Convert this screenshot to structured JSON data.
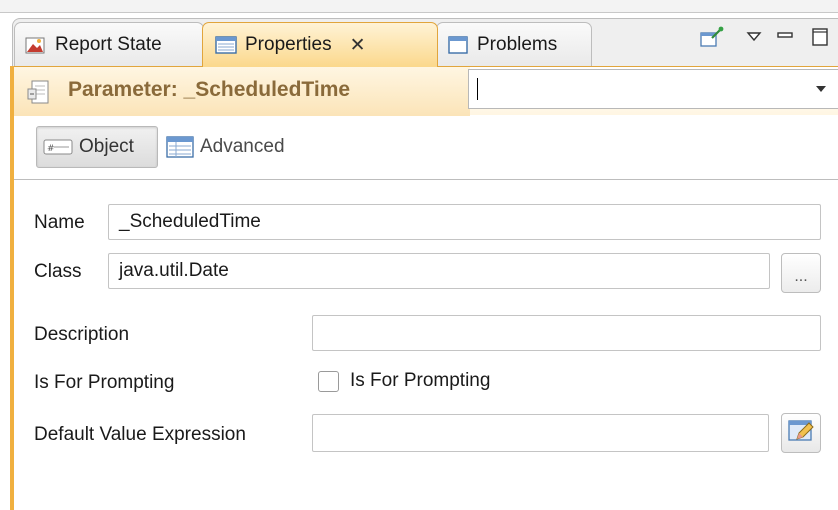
{
  "tabs": [
    {
      "label": "Report State",
      "icon": "report-state-icon"
    },
    {
      "label": "Properties",
      "icon": "properties-icon",
      "active": true
    },
    {
      "label": "Problems",
      "icon": "problems-icon"
    }
  ],
  "toolbar_icons": [
    "pin-icon",
    "view-menu-icon",
    "minimize-icon",
    "maximize-icon"
  ],
  "header": {
    "title": "Parameter: _ScheduledTime",
    "icon": "parameter-icon",
    "combo_value": ""
  },
  "modes": {
    "object_label": "Object",
    "advanced_label": "Advanced"
  },
  "form": {
    "name_label": "Name",
    "name_value": "_ScheduledTime",
    "class_label": "Class",
    "class_value": "java.util.Date",
    "browse_label": "...",
    "description_label": "Description",
    "description_value": "",
    "prompting_label": "Is For Prompting",
    "prompting_checkbox_label": "Is For Prompting",
    "prompting_checked": false,
    "default_label": "Default Value Expression",
    "default_value": ""
  },
  "colors": {
    "accent": "#f0b040",
    "title_text": "#8a6a3a",
    "active_tab": "#fbd88c"
  }
}
